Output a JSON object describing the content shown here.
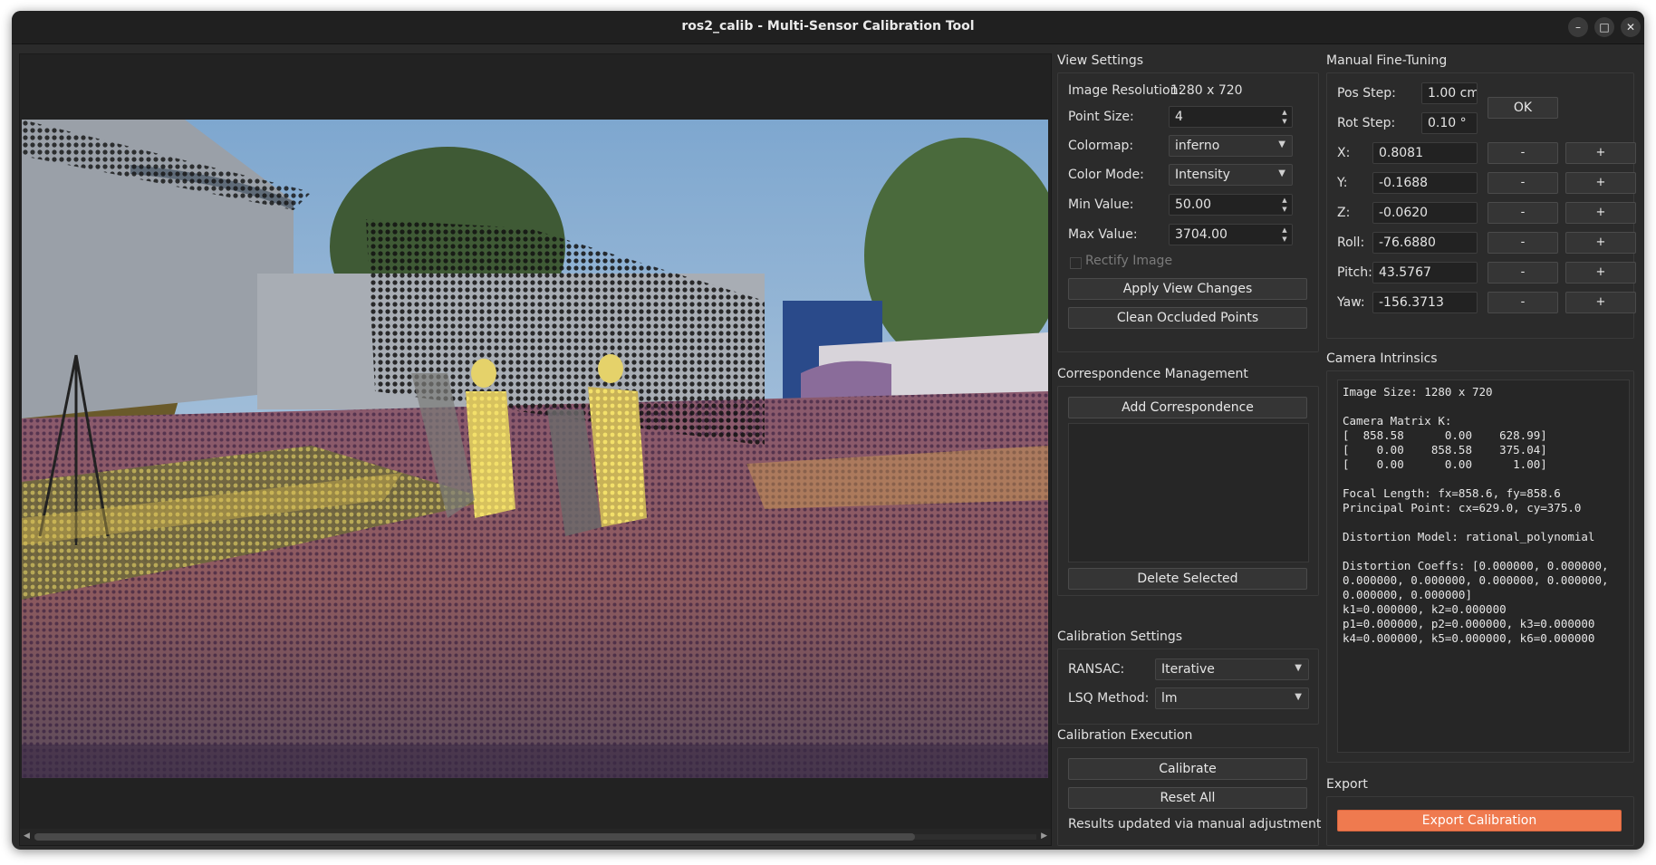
{
  "window": {
    "title": "ros2_calib - Multi-Sensor Calibration Tool",
    "controls": [
      "–",
      "□",
      "✕"
    ]
  },
  "view_settings": {
    "title": "View Settings",
    "image_resolution_label": "Image Resolution:",
    "image_resolution_value": "1280 x 720",
    "point_size_label": "Point Size:",
    "point_size_value": "4",
    "colormap_label": "Colormap:",
    "colormap_value": "inferno",
    "color_mode_label": "Color Mode:",
    "color_mode_value": "Intensity",
    "min_value_label": "Min Value:",
    "min_value_value": "50.00",
    "max_value_label": "Max Value:",
    "max_value_value": "3704.00",
    "rectify_label": "Rectify Image",
    "rectify_checked": false,
    "apply_label": "Apply View Changes",
    "clean_label": "Clean Occluded Points"
  },
  "manual": {
    "title": "Manual Fine-Tuning",
    "pos_step_label": "Pos Step:",
    "pos_step_value": "1.00 cm",
    "rot_step_label": "Rot Step:",
    "rot_step_value": "0.10 °",
    "ok_label": "OK",
    "minus": "-",
    "plus": "+",
    "rows": [
      {
        "label": "X:",
        "value": "0.8081"
      },
      {
        "label": "Y:",
        "value": "-0.1688"
      },
      {
        "label": "Z:",
        "value": "-0.0620"
      },
      {
        "label": "Roll:",
        "value": "-76.6880"
      },
      {
        "label": "Pitch:",
        "value": "43.5767"
      },
      {
        "label": "Yaw:",
        "value": "-156.3713"
      }
    ]
  },
  "correspondence": {
    "title": "Correspondence Management",
    "add_label": "Add Correspondence",
    "delete_label": "Delete Selected"
  },
  "intrinsics": {
    "title": "Camera Intrinsics",
    "lines": [
      "Image Size: 1280 x 720",
      "",
      "Camera Matrix K:",
      "[  858.58      0.00    628.99]",
      "[    0.00    858.58    375.04]",
      "[    0.00      0.00      1.00]",
      "",
      "Focal Length: fx=858.6, fy=858.6",
      "Principal Point: cx=629.0, cy=375.0",
      "",
      "Distortion Model: rational_polynomial",
      "",
      "Distortion Coeffs: [0.000000, 0.000000,",
      "0.000000, 0.000000, 0.000000, 0.000000,",
      "0.000000, 0.000000]",
      "k1=0.000000, k2=0.000000",
      "p1=0.000000, p2=0.000000, k3=0.000000",
      "k4=0.000000, k5=0.000000, k6=0.000000"
    ]
  },
  "calibration_settings": {
    "title": "Calibration Settings",
    "ransac_label": "RANSAC:",
    "ransac_value": "Iterative",
    "lsq_label": "LSQ Method:",
    "lsq_value": "lm"
  },
  "execution": {
    "title": "Calibration Execution",
    "calibrate_label": "Calibrate",
    "reset_label": "Reset All",
    "status": "Results updated via manual adjustment"
  },
  "export": {
    "title": "Export",
    "button_label": "Export Calibration"
  },
  "colors": {
    "accent": "#ef7a4f",
    "window_bg": "#2b2b2b",
    "titlebar_bg": "#202020"
  }
}
